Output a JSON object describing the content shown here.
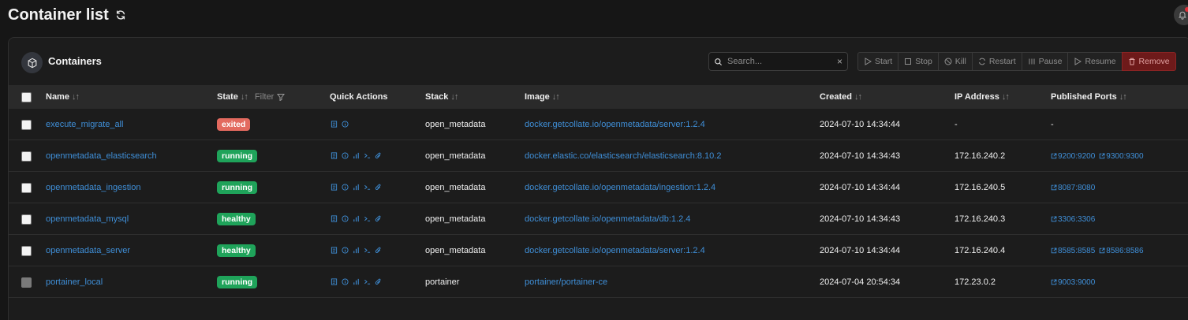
{
  "page": {
    "title": "Container list"
  },
  "panel": {
    "title": "Containers"
  },
  "search": {
    "placeholder": "Search...",
    "value": "",
    "clear": "×"
  },
  "actions": {
    "start": "Start",
    "stop": "Stop",
    "kill": "Kill",
    "restart": "Restart",
    "pause": "Pause",
    "resume": "Resume",
    "remove": "Remove"
  },
  "columns": {
    "name": "Name",
    "state": "State",
    "filter": "Filter",
    "quick_actions": "Quick Actions",
    "stack": "Stack",
    "image": "Image",
    "created": "Created",
    "ip": "IP Address",
    "ports": "Published Ports",
    "sort": "↓↑"
  },
  "colors": {
    "exited": "#e36a5f",
    "running": "#1fa35a",
    "healthy": "#1fa35a",
    "link": "#3f8fd8",
    "remove": "#6e1a1a"
  },
  "containers": [
    {
      "name": "execute_migrate_all",
      "state": "exited",
      "stack": "open_metadata",
      "image": "docker.getcollate.io/openmetadata/server:1.2.4",
      "created": "2024-07-10 14:34:44",
      "ip": "-",
      "ports": [
        "-"
      ]
    },
    {
      "name": "openmetadata_elasticsearch",
      "state": "running",
      "stack": "open_metadata",
      "image": "docker.elastic.co/elasticsearch/elasticsearch:8.10.2",
      "created": "2024-07-10 14:34:43",
      "ip": "172.16.240.2",
      "ports": [
        "9200:9200",
        "9300:9300"
      ]
    },
    {
      "name": "openmetadata_ingestion",
      "state": "running",
      "stack": "open_metadata",
      "image": "docker.getcollate.io/openmetadata/ingestion:1.2.4",
      "created": "2024-07-10 14:34:44",
      "ip": "172.16.240.5",
      "ports": [
        "8087:8080"
      ]
    },
    {
      "name": "openmetadata_mysql",
      "state": "healthy",
      "stack": "open_metadata",
      "image": "docker.getcollate.io/openmetadata/db:1.2.4",
      "created": "2024-07-10 14:34:43",
      "ip": "172.16.240.3",
      "ports": [
        "3306:3306"
      ]
    },
    {
      "name": "openmetadata_server",
      "state": "healthy",
      "stack": "open_metadata",
      "image": "docker.getcollate.io/openmetadata/server:1.2.4",
      "created": "2024-07-10 14:34:44",
      "ip": "172.16.240.4",
      "ports": [
        "8585:8585",
        "8586:8586"
      ]
    },
    {
      "name": "portainer_local",
      "state": "running",
      "stack": "portainer",
      "image": "portainer/portainer-ce",
      "created": "2024-07-04 20:54:34",
      "ip": "172.23.0.2",
      "ports": [
        "9003:9000"
      ]
    }
  ]
}
